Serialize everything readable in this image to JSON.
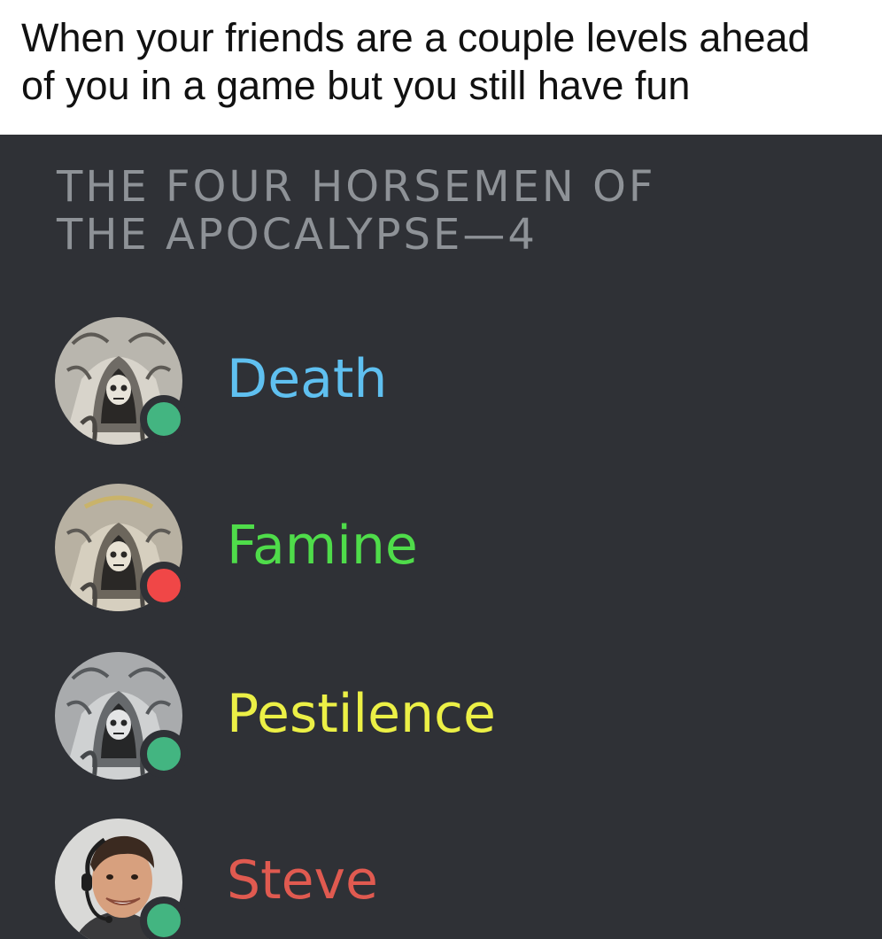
{
  "caption": "When your friends are a couple levels ahead\nof you in a game but you still have fun",
  "role_header": "THE FOUR HORSEMEN OF\nTHE APOCALYPSE—4",
  "members": [
    {
      "name": "Death",
      "name_color": "#5fc0f0",
      "status": "online",
      "status_color": "#43b581",
      "avatar": "reaper-avatar"
    },
    {
      "name": "Famine",
      "name_color": "#4fdc4a",
      "status": "do-not-disturb",
      "status_color": "#f04747",
      "avatar": "reaper-avatar"
    },
    {
      "name": "Pestilence",
      "name_color": "#ecf046",
      "status": "online",
      "status_color": "#43b581",
      "avatar": "reaper-avatar"
    },
    {
      "name": "Steve",
      "name_color": "#e05a50",
      "status": "online",
      "status_color": "#43b581",
      "avatar": "man-with-headset-avatar"
    }
  ]
}
